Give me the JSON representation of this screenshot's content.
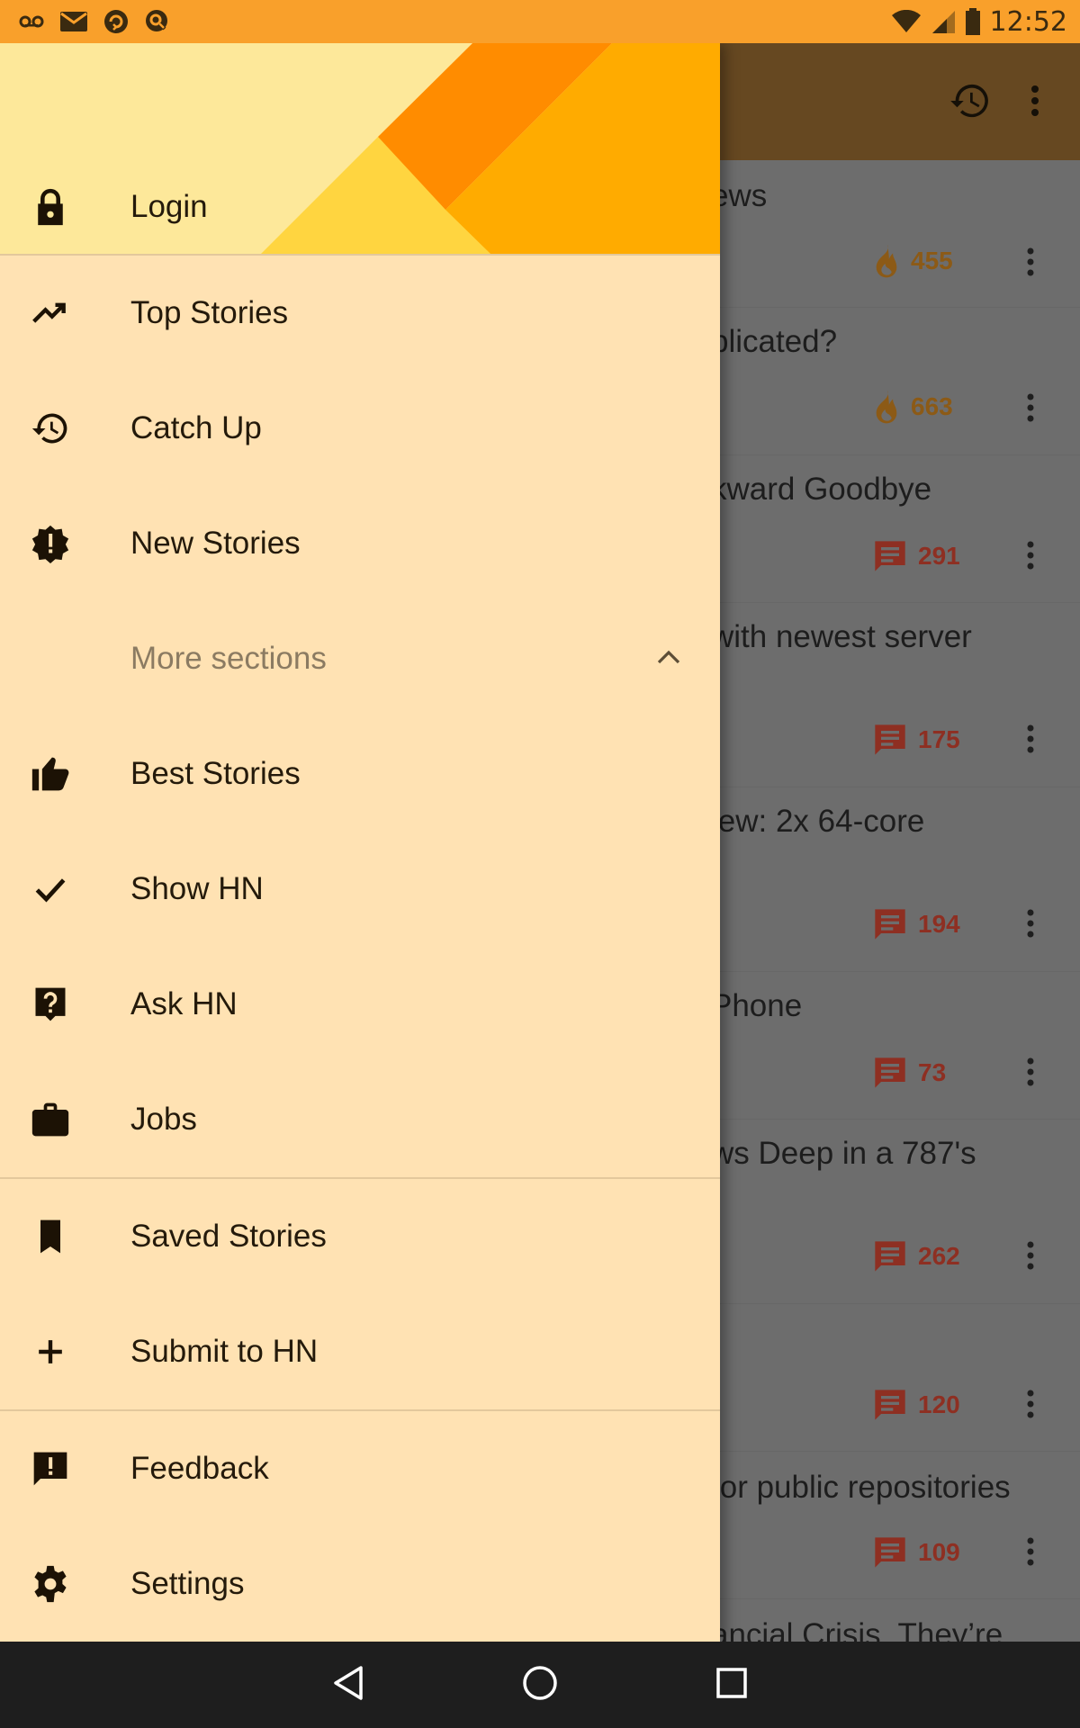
{
  "status_bar": {
    "time": "12:52",
    "icons": [
      "voicemail-icon",
      "mail-icon",
      "sync-icon",
      "search-app-icon",
      "wifi-icon",
      "signal-icon",
      "battery-icon"
    ]
  },
  "drawer": {
    "login_label": "Login",
    "items": [
      {
        "label": "Top Stories",
        "icon": "trending-up-icon"
      },
      {
        "label": "Catch Up",
        "icon": "history-icon"
      },
      {
        "label": "New Stories",
        "icon": "new-releases-icon"
      },
      {
        "label": "More sections",
        "icon": "chevron-up-icon"
      },
      {
        "label": "Best Stories",
        "icon": "thumb-up-icon"
      },
      {
        "label": "Show HN",
        "icon": "check-icon"
      },
      {
        "label": "Ask HN",
        "icon": "help-icon"
      },
      {
        "label": "Jobs",
        "icon": "work-icon"
      },
      {
        "label": "Saved Stories",
        "icon": "bookmark-icon"
      },
      {
        "label": "Submit to HN",
        "icon": "add-icon"
      },
      {
        "label": "Feedback",
        "icon": "feedback-icon"
      },
      {
        "label": "Settings",
        "icon": "settings-icon"
      }
    ],
    "colors": {
      "header_light": "#fde89a",
      "header_orange": "#ff8c00",
      "header_amber": "#ffab00",
      "header_yellow": "#ffd540",
      "drawer_bg": "#ffe2b3"
    }
  },
  "background": {
    "toolbar_icons": [
      "history-icon",
      "more-vert-icon"
    ],
    "stories": [
      {
        "title": "ews",
        "count": "455",
        "kind": "hot"
      },
      {
        "title": "plicated?",
        "count": "663",
        "kind": "hot"
      },
      {
        "title": "kward Goodbye",
        "count": "291",
        "kind": "comments"
      },
      {
        "title": "with newest server",
        "count": "175",
        "kind": "comments"
      },
      {
        "title": "iew: 2x 64-core",
        "count": "194",
        "kind": "comments"
      },
      {
        "title": "Phone",
        "count": "73",
        "kind": "comments"
      },
      {
        "title": "ws Deep in a 787's",
        "count": "262",
        "kind": "comments"
      },
      {
        "title": "",
        "count": "120",
        "kind": "comments"
      },
      {
        "title": "for public repositories",
        "count": "109",
        "kind": "comments"
      },
      {
        "title": "ancial Crisis. They’re",
        "count": "",
        "kind": "comments"
      }
    ]
  },
  "nav_bar": {
    "icons": [
      "back-icon",
      "home-icon",
      "recents-icon"
    ]
  }
}
